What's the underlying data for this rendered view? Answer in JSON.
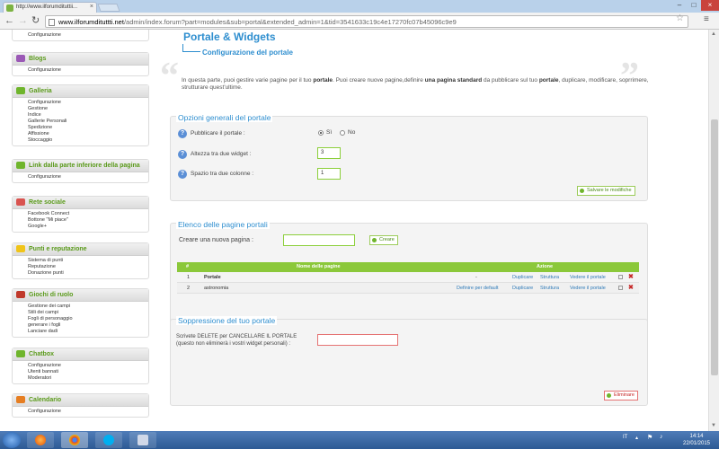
{
  "browser": {
    "tab_title": "http://www.ilforumdituttii...",
    "url_host": "www.ilforumdituttti.net",
    "url_path": "/admin/index.forum?part=modules&sub=portal&extended_admin=1&tid=3541633c19c4e17270fc07b45096c9e9"
  },
  "sidebar": {
    "blocks": [
      {
        "title": "",
        "items": [
          "Configurazione"
        ]
      },
      {
        "title": "Blogs",
        "icon": "blog-icon",
        "color": "#9b59b6",
        "items": [
          "Configurazione"
        ]
      },
      {
        "title": "Galleria",
        "icon": "gallery-icon",
        "color": "#6fb52c",
        "items": [
          "Configurazione",
          "Gestione",
          "Indice",
          "Gallerie Personali",
          "Spedizione",
          "Affissione",
          "Stoccaggio"
        ]
      },
      {
        "title": "Link dalla parte inferiore della pagina",
        "icon": "link-icon",
        "color": "#6fb52c",
        "items": [
          "Configurazione"
        ]
      },
      {
        "title": "Rete sociale",
        "icon": "social-icon",
        "color": "#d9534f",
        "items": [
          "Facebook Connect",
          "Bottone \"Mi piace\"",
          "Google+"
        ]
      },
      {
        "title": "Punti e reputazione",
        "icon": "star-icon",
        "color": "#f0c419",
        "items": [
          "Sistema di punti",
          "Reputazione",
          "Donazione punti"
        ]
      },
      {
        "title": "Giochi di ruolo",
        "icon": "rpg-icon",
        "color": "#c0392b",
        "items": [
          "Gestione dei campi",
          "Stili dei campi",
          "Fogli di personaggio",
          "generare i fogli",
          "Lanciare dadi"
        ]
      },
      {
        "title": "Chatbox",
        "icon": "chat-icon",
        "color": "#6fb52c",
        "items": [
          "Configurazione",
          "Utenti bannati",
          "Moderatori"
        ]
      },
      {
        "title": "Calendario",
        "icon": "calendar-icon",
        "color": "#e67e22",
        "items": [
          "Configurazione"
        ]
      }
    ]
  },
  "page": {
    "title": "Portale & Widgets",
    "subtitle": "Configurazione del portale",
    "intro_1": "In questa parte, puoi gestire varie pagine per il tuo ",
    "intro_b1": "portale",
    "intro_2": ". Puoi creare nuove pagine,definire ",
    "intro_b2": "una pagina standard",
    "intro_3": " da pubblicare sul tuo ",
    "intro_b3": "portale",
    "intro_4": ", duplicare, modificare, soprrimere, strutturare quest'ultime."
  },
  "general": {
    "heading": "Opzioni generali del portale",
    "publish_label": "Pubblicare il portale :",
    "yes": "Sì",
    "no": "No",
    "publish_value": "Sì",
    "widget_gap_label": "Altezza tra due widget :",
    "widget_gap_value": "3",
    "column_gap_label": "Spazio tra due colonne :",
    "column_gap_value": "1",
    "save": "Salvare le modifiche"
  },
  "pages": {
    "heading": "Elenco delle pagine portali",
    "create_label": "Creare una nuova pagina :",
    "create_value": "",
    "create_button": "Creare",
    "columns": [
      "#",
      "Nome delle pagine",
      "Azione"
    ],
    "rows": [
      {
        "num": "1",
        "name": "Portale",
        "default": "-",
        "duplicate": "Duplicare",
        "structure": "Struttura",
        "view": "Vedere il portale"
      },
      {
        "num": "2",
        "name": "astronomia",
        "default": "Definire per default",
        "duplicate": "Duplicare",
        "structure": "Struttura",
        "view": "Vedere il portale"
      }
    ]
  },
  "delete": {
    "heading": "Soppressione del tuo portale",
    "label": "Scrivete DELETE per CANCELLARE IL PORTALE (questo non eliminerà i vostri widget personali) :",
    "value": "",
    "button": "Eliminare"
  },
  "taskbar": {
    "lang": "IT",
    "time": "14:14",
    "date": "22/01/2015"
  }
}
